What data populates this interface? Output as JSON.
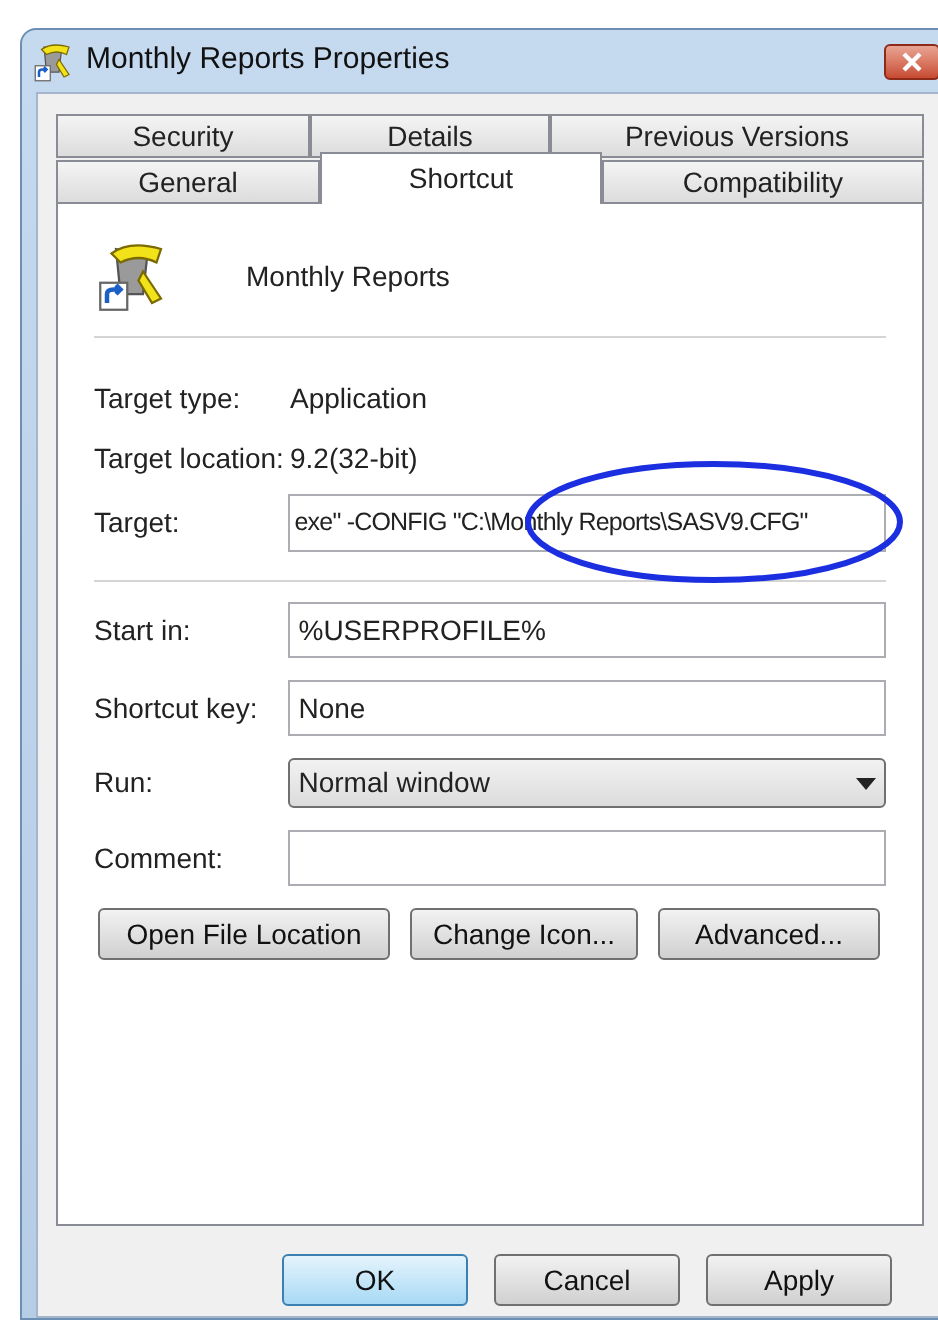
{
  "window": {
    "title": "Monthly Reports Properties"
  },
  "tab_rows": [
    [
      {
        "label": "Security",
        "selected": false
      },
      {
        "label": "Details",
        "selected": false
      },
      {
        "label": "Previous Versions",
        "selected": false
      }
    ],
    [
      {
        "label": "General",
        "selected": false
      },
      {
        "label": "Shortcut",
        "selected": true
      },
      {
        "label": "Compatibility",
        "selected": false
      }
    ]
  ],
  "shortcut_name": "Monthly Reports",
  "info": [
    {
      "label": "Target type:",
      "value": "Application"
    },
    {
      "label": "Target location:",
      "value": "9.2(32-bit)"
    }
  ],
  "target": {
    "label": "Target:",
    "value": "exe\" -CONFIG \"C:\\Monthly Reports\\SASV9.CFG\"",
    "highlighted": true
  },
  "fields": [
    {
      "kind": "text",
      "label": "Start in:",
      "value": "%USERPROFILE%"
    },
    {
      "kind": "text",
      "label": "Shortcut key:",
      "value": "None"
    },
    {
      "kind": "dropdown",
      "label": "Run:",
      "value": "Normal window"
    },
    {
      "kind": "text",
      "label": "Comment:"
    }
  ],
  "actions": [
    "Open File Location",
    "Change Icon...",
    "Advanced..."
  ],
  "buttons": [
    {
      "label": "OK",
      "default": true
    },
    {
      "label": "Cancel",
      "default": false
    },
    {
      "label": "Apply",
      "default": false
    }
  ]
}
